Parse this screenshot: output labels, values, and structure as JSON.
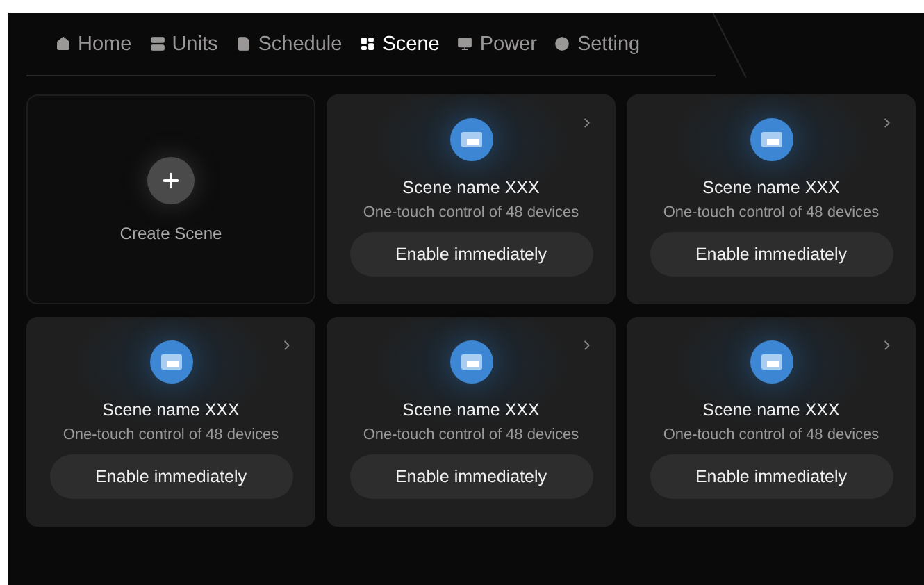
{
  "tabs": [
    {
      "label": "Home",
      "kind": "home",
      "selected": false
    },
    {
      "label": "Units",
      "kind": "units",
      "selected": false
    },
    {
      "label": "Schedule",
      "kind": "schedule",
      "selected": false
    },
    {
      "label": "Scene",
      "kind": "scene",
      "selected": true
    },
    {
      "label": "Power",
      "kind": "power",
      "selected": false
    },
    {
      "label": "Setting",
      "kind": "setting",
      "selected": false
    }
  ],
  "cards": [
    {
      "kind": "create",
      "label": "Create Scene"
    },
    {
      "kind": "scene",
      "title": "Scene name XXX",
      "subtitle": "One-touch control of 48 devices",
      "button": "Enable immediately"
    },
    {
      "kind": "scene",
      "title": "Scene name XXX",
      "subtitle": "One-touch control of 48 devices",
      "button": "Enable immediately"
    },
    {
      "kind": "scene",
      "title": "Scene name XXX",
      "subtitle": "One-touch control of 48 devices",
      "button": "Enable immediately"
    },
    {
      "kind": "scene",
      "title": "Scene name XXX",
      "subtitle": "One-touch control of 48 devices",
      "button": "Enable immediately"
    },
    {
      "kind": "scene",
      "title": "Scene name XXX",
      "subtitle": "One-touch control of 48 devices",
      "button": "Enable immediately"
    }
  ]
}
